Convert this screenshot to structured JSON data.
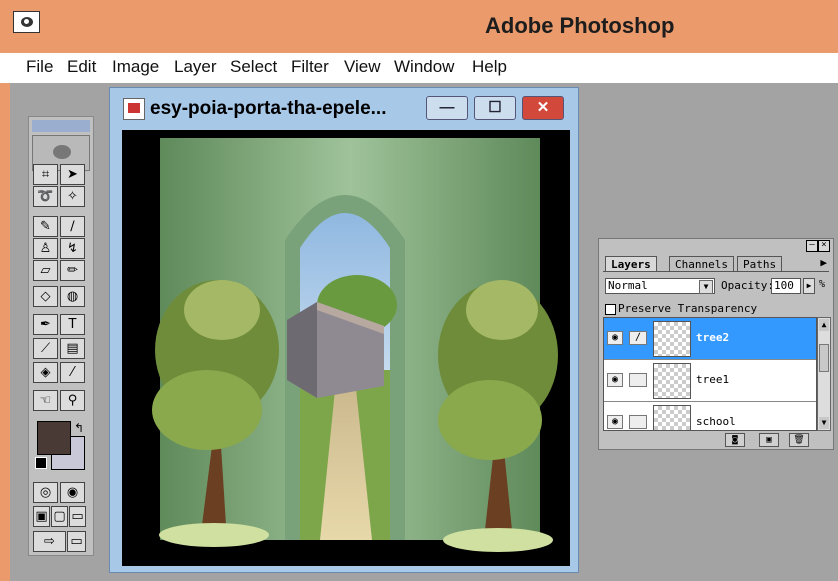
{
  "app": {
    "title": "Adobe Photoshop"
  },
  "menu": [
    "File",
    "Edit",
    "Image",
    "Layer",
    "Select",
    "Filter",
    "View",
    "Window",
    "Help"
  ],
  "document": {
    "title": "esy-poia-porta-tha-epele...",
    "controls": {
      "minimize": "—",
      "maximize": "☐",
      "close": "✕"
    }
  },
  "toolbox": {
    "tools": [
      {
        "name": "crop-tool",
        "glyph": "⌗"
      },
      {
        "name": "move-tool",
        "glyph": "➤"
      },
      {
        "name": "lasso-tool",
        "glyph": "➰"
      },
      {
        "name": "magic-wand-tool",
        "glyph": "✧"
      },
      {
        "name": "pen-tool",
        "glyph": "✎"
      },
      {
        "name": "brush-tool",
        "glyph": "∕"
      },
      {
        "name": "stamp-tool",
        "glyph": "♙"
      },
      {
        "name": "history-brush-tool",
        "glyph": "↯"
      },
      {
        "name": "eraser-tool",
        "glyph": "▱"
      },
      {
        "name": "pencil-tool",
        "glyph": "✏"
      },
      {
        "name": "blur-tool",
        "glyph": "◇"
      },
      {
        "name": "sponge-tool",
        "glyph": "◍"
      },
      {
        "name": "path-tool",
        "glyph": "✒"
      },
      {
        "name": "type-tool",
        "glyph": "T"
      },
      {
        "name": "measure-tool",
        "glyph": "⟋"
      },
      {
        "name": "gradient-tool",
        "glyph": "▤"
      },
      {
        "name": "paint-bucket-tool",
        "glyph": "◈"
      },
      {
        "name": "eyedropper-tool",
        "glyph": "⁄"
      },
      {
        "name": "hand-tool",
        "glyph": "☜"
      },
      {
        "name": "zoom-tool",
        "glyph": "⚲"
      },
      {
        "name": "standard-mode-tool",
        "glyph": "◎"
      },
      {
        "name": "quick-mask-tool",
        "glyph": "◉"
      },
      {
        "name": "screen-mode-1",
        "glyph": "▣"
      },
      {
        "name": "screen-mode-2",
        "glyph": "▢"
      },
      {
        "name": "jump-to-tool",
        "glyph": "⇨"
      },
      {
        "name": "screen-mode-3",
        "glyph": "▭"
      }
    ],
    "colors": {
      "foreground": "#4a3a35",
      "background": "#c8c8d8"
    }
  },
  "layers_palette": {
    "tabs": [
      "Layers",
      "Channels",
      "Paths"
    ],
    "blend_mode": "Normal",
    "opacity_label": "Opacity:",
    "opacity_value": "100",
    "opacity_unit": "%",
    "preserve_label": "Preserve Transparency",
    "layers": [
      {
        "name": "tree2",
        "selected": true
      },
      {
        "name": "tree1",
        "selected": false
      },
      {
        "name": "school",
        "selected": false
      }
    ]
  }
}
